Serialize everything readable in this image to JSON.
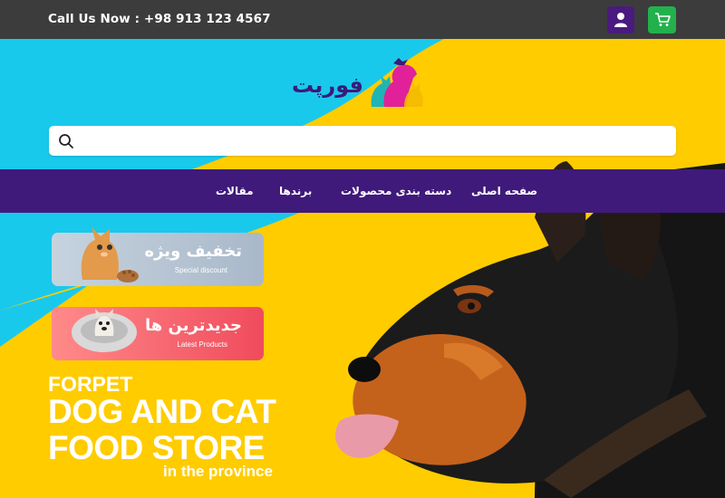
{
  "header": {
    "phone_text": "Call Us Now :  +98 913 123 4567",
    "user_icon": "user-icon",
    "cart_icon": "cart-icon"
  },
  "logo": {
    "text": "فورپت"
  },
  "search": {
    "placeholder": "",
    "value": "",
    "icon": "search-icon"
  },
  "nav": {
    "items": [
      {
        "label": "صفحه اصلی"
      },
      {
        "label": "دسته بندی محصولات"
      },
      {
        "label": "برندها"
      },
      {
        "label": "مقالات"
      }
    ]
  },
  "promos": [
    {
      "title": "تخفیف ویژه",
      "subtitle": "Special discount"
    },
    {
      "title": "جدیدترین ها",
      "subtitle": "Latest Products"
    }
  ],
  "hero": {
    "kicker": "FORPET",
    "line1": "DOG AND CAT",
    "line2": "FOOD STORE",
    "sub": "in the province"
  },
  "colors": {
    "topbar": "#3c3c3c",
    "nav": "#3f1a7a",
    "cyan": "#19c9ec",
    "yellow": "#ffcc00",
    "cart": "#22b14c",
    "user": "#4a1a7f"
  }
}
